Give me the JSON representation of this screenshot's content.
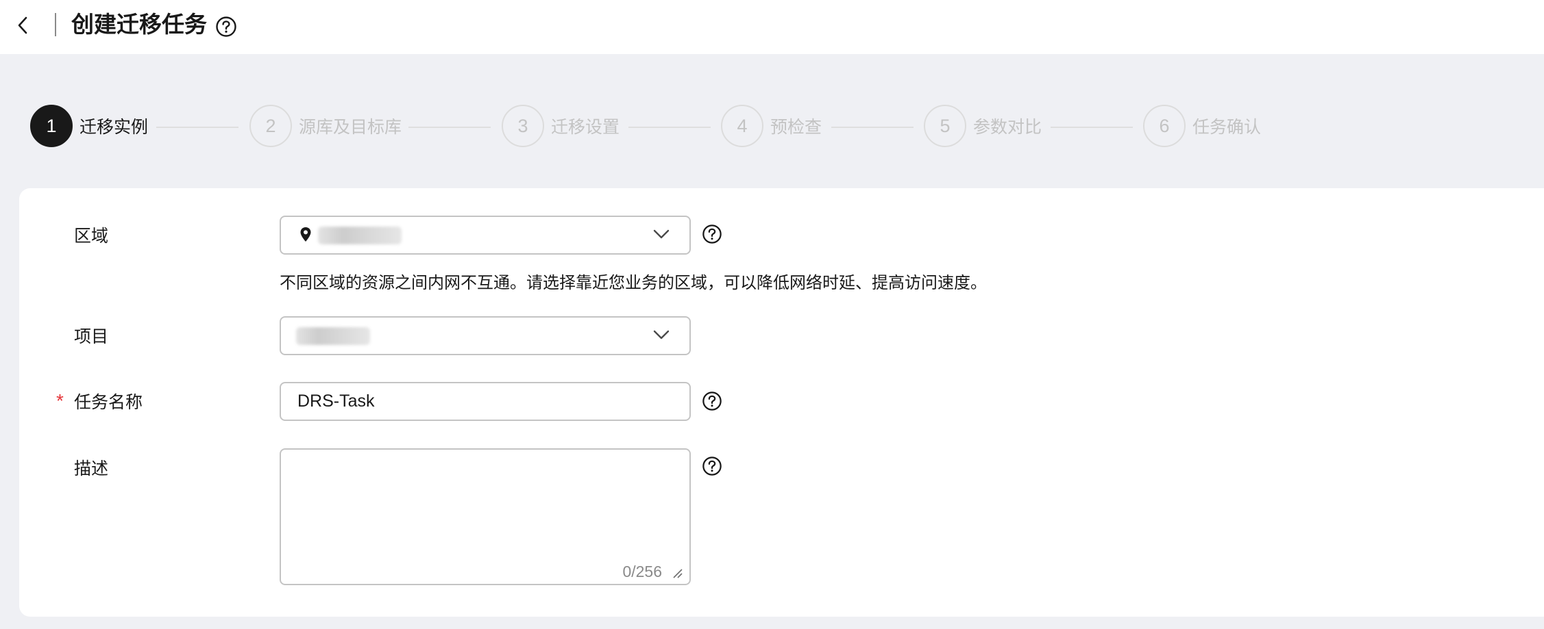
{
  "header": {
    "title": "创建迁移任务",
    "back_icon": "chevron-left-icon",
    "help_icon": "question-circle-icon"
  },
  "steps": [
    {
      "number": "1",
      "label": "迁移实例",
      "active": true
    },
    {
      "number": "2",
      "label": "源库及目标库",
      "active": false
    },
    {
      "number": "3",
      "label": "迁移设置",
      "active": false
    },
    {
      "number": "4",
      "label": "预检查",
      "active": false
    },
    {
      "number": "5",
      "label": "参数对比",
      "active": false
    },
    {
      "number": "6",
      "label": "任务确认",
      "active": false
    }
  ],
  "form": {
    "region": {
      "label": "区域",
      "hint": "不同区域的资源之间内网不互通。请选择靠近您业务的区域，可以降低网络时延、提高访问速度。",
      "icon": "location-pin-icon"
    },
    "project": {
      "label": "项目"
    },
    "task_name": {
      "label": "任务名称",
      "required_mark": "*",
      "value": "DRS-Task"
    },
    "description": {
      "label": "描述",
      "value": "",
      "counter": "0/256"
    }
  },
  "colors": {
    "page_bg": "#eff0f4",
    "active_step": "#191919",
    "inactive_step": "#c3c3c3",
    "required": "#e5353a",
    "border": "#c4c4c4"
  }
}
